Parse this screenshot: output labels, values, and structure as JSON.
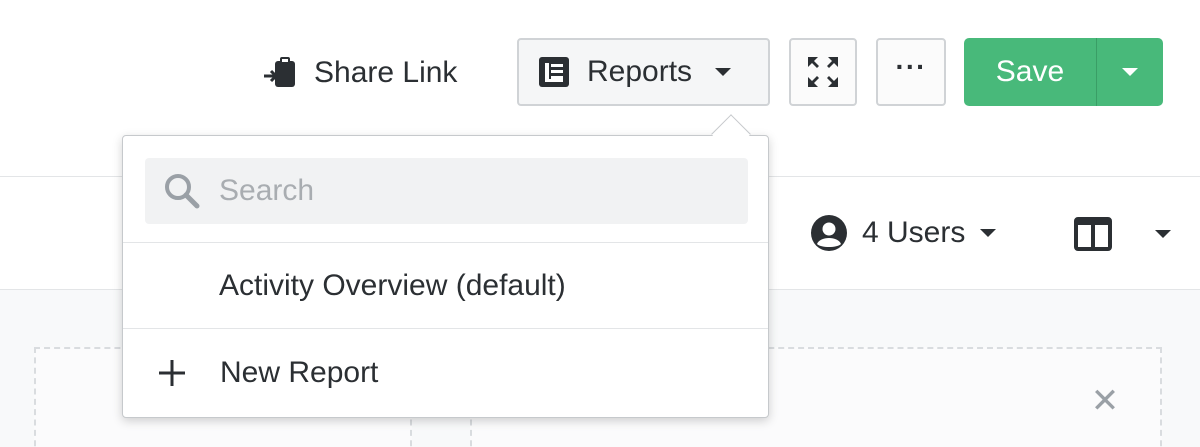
{
  "toolbar": {
    "share_link_label": "Share Link",
    "reports_label": "Reports",
    "more_label": "···",
    "save_label": "Save"
  },
  "filters": {
    "users_label": "4 Users"
  },
  "reports_dropdown": {
    "search": {
      "placeholder": "Search",
      "value": ""
    },
    "items": [
      {
        "label": "Activity Overview (default)"
      }
    ],
    "new_report_label": "New Report"
  },
  "colors": {
    "save_green": "#48b97a",
    "text": "#2b2f33",
    "border": "#d0d3d6"
  },
  "icons": {
    "share": "share-clipboard-icon",
    "reports": "report-icon",
    "fullscreen": "expand-icon",
    "user": "user-circle-icon",
    "layout": "split-columns-icon",
    "search": "search-icon",
    "add": "plus-icon",
    "close": "close-icon"
  }
}
